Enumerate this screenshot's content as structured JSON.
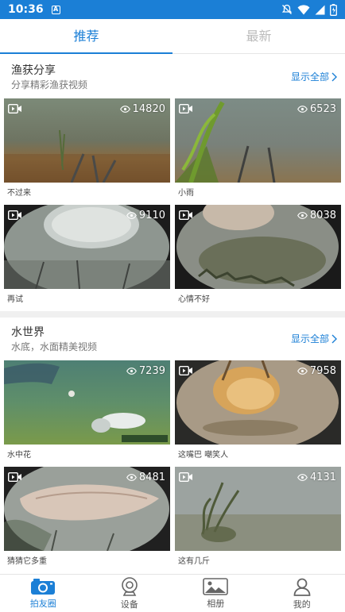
{
  "status": {
    "time": "10:36"
  },
  "tabs": [
    {
      "label": "推荐",
      "active": true
    },
    {
      "label": "最新",
      "active": false
    }
  ],
  "sections": [
    {
      "title": "渔获分享",
      "subtitle": "分享精彩渔获视频",
      "more": "显示全部",
      "videos": [
        {
          "label": "不过来",
          "views": "14820"
        },
        {
          "label": "小雨",
          "views": "6523"
        },
        {
          "label": "再试",
          "views": "9110"
        },
        {
          "label": "心情不好",
          "views": "8038"
        }
      ]
    },
    {
      "title": "水世界",
      "subtitle": "水底，水面精美视频",
      "more": "显示全部",
      "videos": [
        {
          "label": "水中花",
          "views": "7239"
        },
        {
          "label": "这嘴巴 嘲笑人",
          "views": "7958"
        },
        {
          "label": "猜猜它多重",
          "views": "8481"
        },
        {
          "label": "这有几斤",
          "views": "4131"
        }
      ]
    }
  ],
  "bottom_nav": [
    {
      "label": "拍友圈",
      "icon": "camera-icon",
      "active": true
    },
    {
      "label": "设备",
      "icon": "webcam-icon",
      "active": false
    },
    {
      "label": "相册",
      "icon": "gallery-icon",
      "active": false
    },
    {
      "label": "我的",
      "icon": "profile-icon",
      "active": false
    }
  ],
  "colors": {
    "accent": "#1b7fd6"
  }
}
